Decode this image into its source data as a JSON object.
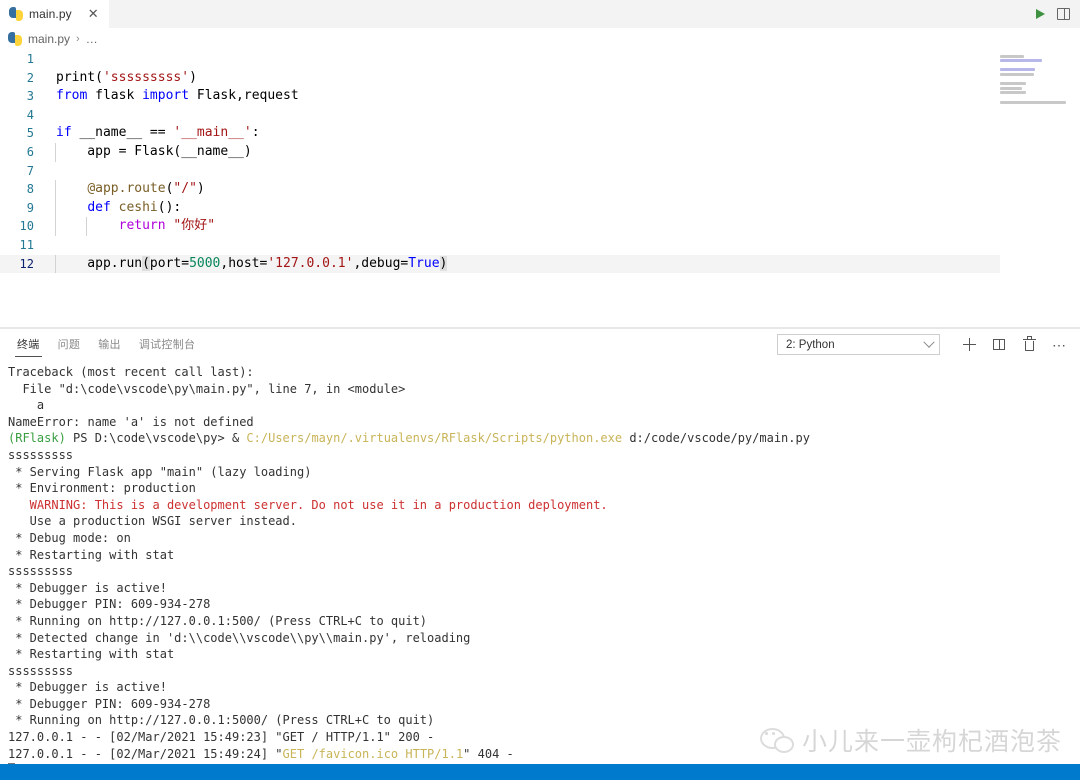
{
  "window": {
    "tab": {
      "filename": "main.py",
      "icon": "python-file-icon",
      "close_label": "✕"
    },
    "actions": {
      "run_label": "run-python-file",
      "split_label": "split-editor"
    }
  },
  "breadcrumb": {
    "icon": "python-file-icon",
    "file": "main.py",
    "separator": "›",
    "ellipsis": "…"
  },
  "editor": {
    "language": "python",
    "lines": [
      {
        "n": "1",
        "tokens": []
      },
      {
        "n": "2",
        "tokens": [
          {
            "t": "print(",
            "c": "plain"
          },
          {
            "t": "'sssssssss'",
            "c": "str"
          },
          {
            "t": ")",
            "c": "plain"
          }
        ]
      },
      {
        "n": "3",
        "tokens": [
          {
            "t": "from",
            "c": "kw"
          },
          {
            "t": " flask ",
            "c": "plain"
          },
          {
            "t": "import",
            "c": "kw"
          },
          {
            "t": " Flask,request",
            "c": "plain"
          }
        ]
      },
      {
        "n": "4",
        "tokens": []
      },
      {
        "n": "5",
        "tokens": [
          {
            "t": "if",
            "c": "kw"
          },
          {
            "t": " __name__ == ",
            "c": "plain"
          },
          {
            "t": "'__main__'",
            "c": "str"
          },
          {
            "t": ":",
            "c": "plain"
          }
        ]
      },
      {
        "n": "6",
        "tokens": [
          {
            "t": "    app = Flask(__name__)",
            "c": "plain"
          }
        ]
      },
      {
        "n": "7",
        "tokens": []
      },
      {
        "n": "8",
        "tokens": [
          {
            "t": "    ",
            "c": "plain"
          },
          {
            "t": "@app.route",
            "c": "dec"
          },
          {
            "t": "(",
            "c": "plain"
          },
          {
            "t": "\"/\"",
            "c": "str"
          },
          {
            "t": ")",
            "c": "plain"
          }
        ]
      },
      {
        "n": "9",
        "tokens": [
          {
            "t": "    ",
            "c": "plain"
          },
          {
            "t": "def",
            "c": "kw"
          },
          {
            "t": " ",
            "c": "plain"
          },
          {
            "t": "ceshi",
            "c": "fn"
          },
          {
            "t": "():",
            "c": "plain"
          }
        ]
      },
      {
        "n": "10",
        "tokens": [
          {
            "t": "        ",
            "c": "plain"
          },
          {
            "t": "return",
            "c": "kw2"
          },
          {
            "t": " ",
            "c": "plain"
          },
          {
            "t": "\"你好\"",
            "c": "str"
          }
        ]
      },
      {
        "n": "11",
        "tokens": []
      },
      {
        "n": "12",
        "tokens": [
          {
            "t": "    app.run",
            "c": "plain"
          },
          {
            "t": "(",
            "c": "brk"
          },
          {
            "t": "port=",
            "c": "plain"
          },
          {
            "t": "5000",
            "c": "num"
          },
          {
            "t": ",host=",
            "c": "plain"
          },
          {
            "t": "'127.0.0.1'",
            "c": "str"
          },
          {
            "t": ",debug=",
            "c": "plain"
          },
          {
            "t": "True",
            "c": "const"
          },
          {
            "t": ")",
            "c": "brk"
          }
        ]
      }
    ],
    "current_line": "12"
  },
  "panel": {
    "tabs": [
      {
        "label": "终端",
        "active": true
      },
      {
        "label": "问题",
        "active": false
      },
      {
        "label": "输出",
        "active": false
      },
      {
        "label": "调试控制台",
        "active": false
      }
    ],
    "terminal_select": {
      "value": "2: Python",
      "chevron": "chevron-down-icon"
    },
    "buttons": [
      {
        "name": "new-terminal-button",
        "icon": "plus-icon"
      },
      {
        "name": "split-terminal-button",
        "icon": "split-icon"
      },
      {
        "name": "kill-terminal-button",
        "icon": "trash-icon"
      },
      {
        "name": "more-actions-button",
        "icon": "ellipsis-icon"
      }
    ]
  },
  "terminal": {
    "lines": [
      [
        {
          "t": "Traceback (most recent call last):",
          "c": "default"
        }
      ],
      [
        {
          "t": "  File \"d:\\code\\vscode\\py\\main.py\", line 7, in <module>",
          "c": "default"
        }
      ],
      [
        {
          "t": "    a",
          "c": "default"
        }
      ],
      [
        {
          "t": "NameError: name 'a' is not defined",
          "c": "default"
        }
      ],
      [
        {
          "t": "(RFlask)",
          "c": "green"
        },
        {
          "t": " PS D:\\code\\vscode\\py> & ",
          "c": "default"
        },
        {
          "t": "C:/Users/mayn/.virtualenvs/RFlask/Scripts/python.exe",
          "c": "yellowl"
        },
        {
          "t": " d:/code/vscode/py/main.py",
          "c": "default"
        }
      ],
      [
        {
          "t": "sssssssss",
          "c": "default"
        }
      ],
      [
        {
          "t": " * Serving Flask app \"main\" (lazy loading)",
          "c": "default"
        }
      ],
      [
        {
          "t": " * Environment: production",
          "c": "default"
        }
      ],
      [
        {
          "t": "   WARNING: This is a development server. Do not use it in a production deployment.",
          "c": "red"
        }
      ],
      [
        {
          "t": "   Use a production WSGI server instead.",
          "c": "default"
        }
      ],
      [
        {
          "t": " * Debug mode: on",
          "c": "default"
        }
      ],
      [
        {
          "t": " * Restarting with stat",
          "c": "default"
        }
      ],
      [
        {
          "t": "sssssssss",
          "c": "default"
        }
      ],
      [
        {
          "t": " * Debugger is active!",
          "c": "default"
        }
      ],
      [
        {
          "t": " * Debugger PIN: 609-934-278",
          "c": "default"
        }
      ],
      [
        {
          "t": " * Running on http://127.0.0.1:500/ (Press CTRL+C to quit)",
          "c": "default"
        }
      ],
      [
        {
          "t": " * Detected change in 'd:\\\\code\\\\vscode\\\\py\\\\main.py', reloading",
          "c": "default"
        }
      ],
      [
        {
          "t": " * Restarting with stat",
          "c": "default"
        }
      ],
      [
        {
          "t": "sssssssss",
          "c": "default"
        }
      ],
      [
        {
          "t": " * Debugger is active!",
          "c": "default"
        }
      ],
      [
        {
          "t": " * Debugger PIN: 609-934-278",
          "c": "default"
        }
      ],
      [
        {
          "t": " * Running on http://127.0.0.1:5000/ (Press CTRL+C to quit)",
          "c": "default"
        }
      ],
      [
        {
          "t": "127.0.0.1 - - [02/Mar/2021 15:49:23] \"GET / HTTP/1.1\" 200 -",
          "c": "default"
        }
      ],
      [
        {
          "t": "127.0.0.1 - - [02/Mar/2021 15:49:24] \"",
          "c": "default"
        },
        {
          "t": "GET /favicon.ico HTTP/1.1",
          "c": "yellowl"
        },
        {
          "t": "\" 404 -",
          "c": "default"
        }
      ]
    ],
    "cursor": "block-cursor"
  },
  "watermark": {
    "icon": "wechat-icon",
    "text": "小儿来一壶枸杞酒泡茶"
  },
  "statusbar": {
    "color": "#007acc",
    "right_text": ""
  }
}
